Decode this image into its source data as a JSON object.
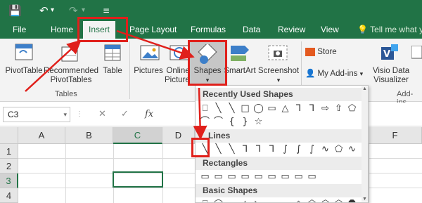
{
  "quick_access": {
    "save_icon": "save-icon",
    "undo_icon": "undo-icon",
    "redo_icon": "redo-icon",
    "customize_icon": "customize-icon"
  },
  "tabs": [
    "File",
    "Home",
    "Insert",
    "Page Layout",
    "Formulas",
    "Data",
    "Review",
    "View"
  ],
  "active_tab": "Insert",
  "tell_me": "Tell me what yo",
  "ribbon": {
    "pivottable": "PivotTable",
    "recommended": [
      "Recommended",
      "PivotTables"
    ],
    "table": "Table",
    "tables_group": "Tables",
    "pictures": "Pictures",
    "online_pictures": [
      "Online",
      "Pictures"
    ],
    "shapes": "Shapes",
    "smartart": "SmartArt",
    "screenshot": "Screenshot",
    "store": "Store",
    "my_addins": "My Add-ins",
    "visio": [
      "Visio Data",
      "Visualizer"
    ],
    "addins_group": "Add-ins"
  },
  "formula_bar": {
    "name_box": "C3",
    "fx": "fx",
    "cancel": "✕",
    "enter": "✓"
  },
  "columns": [
    "A",
    "B",
    "C",
    "D",
    "F"
  ],
  "rows": [
    "1",
    "2",
    "3",
    "4"
  ],
  "selected_cell": "C3",
  "shapes_menu": {
    "recent": "Recently Used Shapes",
    "lines": "Lines",
    "rectangles": "Rectangles",
    "basic": "Basic Shapes",
    "recent_row1": [
      "⎕",
      "╲",
      "╲",
      "□",
      "◯",
      "▭",
      "△",
      "⅂",
      "⅂",
      "⇨",
      "⇧",
      "⬠"
    ],
    "recent_row2": [
      "⌒",
      "⌒",
      "{",
      "}",
      "☆"
    ],
    "lines_row": [
      "╲",
      "╲",
      "╲",
      "⅂",
      "⅂",
      "⅂",
      "∫",
      "∫",
      "∫",
      "∿",
      "⬠",
      "∿"
    ],
    "rect_row": [
      "▭",
      "▭",
      "▭",
      "▭",
      "▭",
      "▭",
      "▭",
      "▭",
      "▭"
    ],
    "basic_row": [
      "⎕",
      "◯",
      "▭",
      "△",
      "◺",
      "▱",
      "⏢",
      "◇",
      "⬠",
      "⬡",
      "⬡",
      "⯃"
    ]
  }
}
